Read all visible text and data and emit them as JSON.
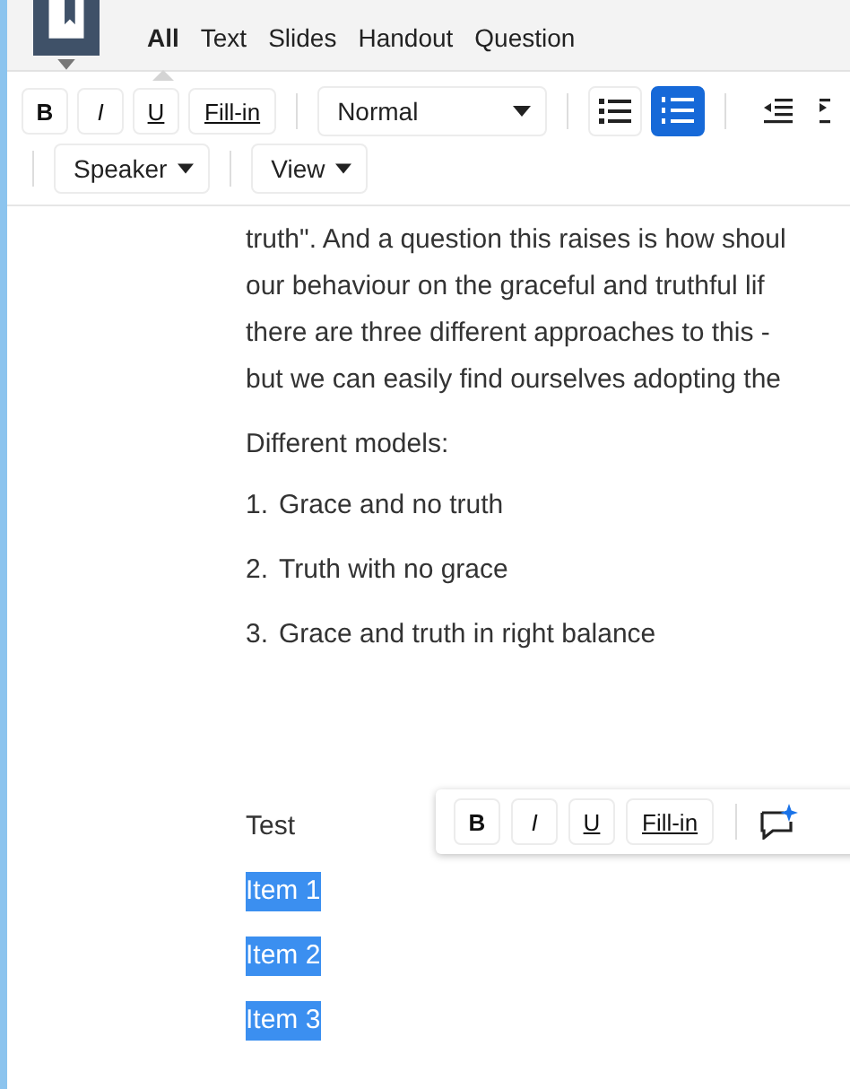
{
  "tabs": [
    {
      "label": "All",
      "selected": true
    },
    {
      "label": "Text",
      "selected": false
    },
    {
      "label": "Slides",
      "selected": false
    },
    {
      "label": "Handout",
      "selected": false
    },
    {
      "label": "Question",
      "selected": false
    }
  ],
  "toolbar": {
    "format_buttons": [
      {
        "label": "B",
        "kind": "bold"
      },
      {
        "label": "I",
        "kind": "italic"
      },
      {
        "label": "U",
        "kind": "underline"
      },
      {
        "label": "Fill-in",
        "kind": "fillin"
      }
    ],
    "style_dropdown": "Normal",
    "list_buttons": [
      {
        "kind": "bullet",
        "selected": false
      },
      {
        "kind": "numbered",
        "selected": true
      }
    ],
    "second_row": [
      "Speaker",
      "View"
    ]
  },
  "paragraph_lines": [
    "truth\". And a question this raises is how shoul",
    "our behaviour on the graceful and truthful lif",
    "there are three different approaches to this -",
    "but we can easily find ourselves adopting the"
  ],
  "heading": "Different models:",
  "numbered_list": [
    {
      "number": "1.",
      "text": "Grace and no truth"
    },
    {
      "number": "2.",
      "text": "Truth with no grace"
    },
    {
      "number": "3.",
      "text": "Grace and truth in right balance"
    }
  ],
  "lines": [
    {
      "text": "Test",
      "selected": false
    },
    {
      "text": "Item 1",
      "selected": true
    },
    {
      "text": "Item 2",
      "selected": true
    },
    {
      "text": "Item 3",
      "selected": true
    }
  ],
  "floating_toolbar": {
    "format_buttons": [
      {
        "label": "B",
        "kind": "bold"
      },
      {
        "label": "I",
        "kind": "italic"
      },
      {
        "label": "U",
        "kind": "underline"
      },
      {
        "label": "Fill-in",
        "kind": "fillin"
      }
    ]
  }
}
